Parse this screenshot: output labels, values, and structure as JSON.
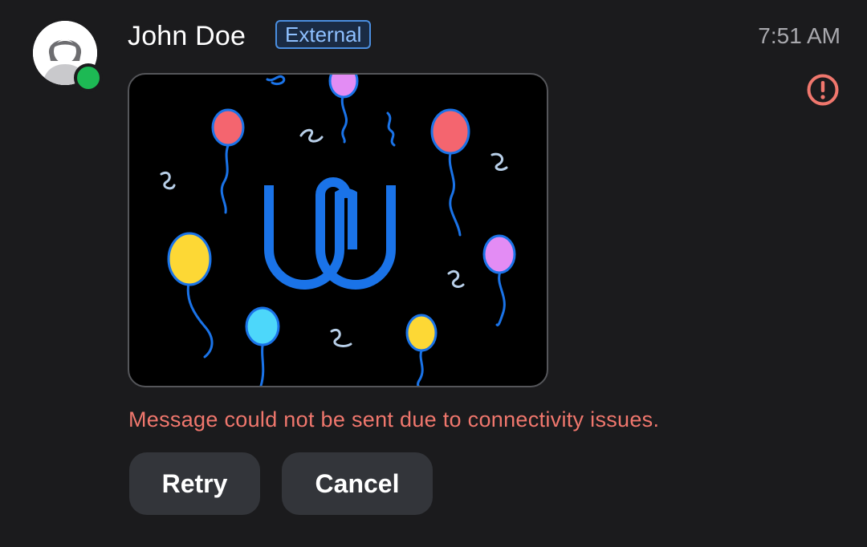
{
  "user": {
    "name": "John Doe",
    "badge": "External",
    "status": "online"
  },
  "message": {
    "time": "7:51 AM",
    "attachment_icon": "celebration-image",
    "error_text": "Message could not be sent due to connectivity issues."
  },
  "actions": {
    "retry_label": "Retry",
    "cancel_label": "Cancel"
  },
  "colors": {
    "background": "#1b1b1d",
    "badge_border": "#4a8ee0",
    "badge_text": "#8ec0ff",
    "error": "#f0776d",
    "status_online": "#1db954",
    "button_bg": "#33353a"
  }
}
